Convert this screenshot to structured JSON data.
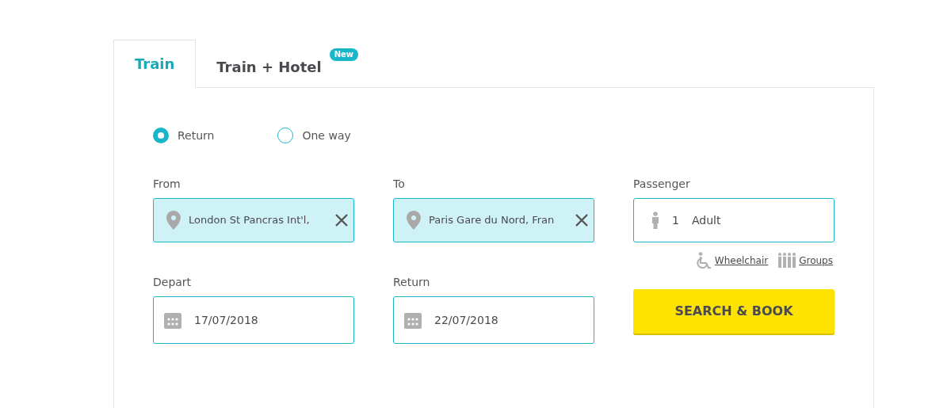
{
  "tabs": [
    {
      "label": "Train",
      "selected": true
    },
    {
      "label": "Train + Hotel",
      "selected": false,
      "badge": "New"
    }
  ],
  "trip_type": [
    {
      "label": "Return",
      "selected": true
    },
    {
      "label": "One way",
      "selected": false
    }
  ],
  "from": {
    "label": "From",
    "value": "London St Pancras Int'l,"
  },
  "to": {
    "label": "To",
    "value": "Paris Gare du Nord, Fran"
  },
  "passenger": {
    "label": "Passenger",
    "count": "1",
    "type": "Adult"
  },
  "passenger_links": [
    {
      "kind": "wheelchair",
      "label": "Wheelchair"
    },
    {
      "kind": "groups",
      "label": "Groups"
    }
  ],
  "depart": {
    "label": "Depart",
    "value": "17/07/2018"
  },
  "return": {
    "label": "Return",
    "value": "22/07/2018"
  },
  "search_button": "SEARCH & BOOK"
}
